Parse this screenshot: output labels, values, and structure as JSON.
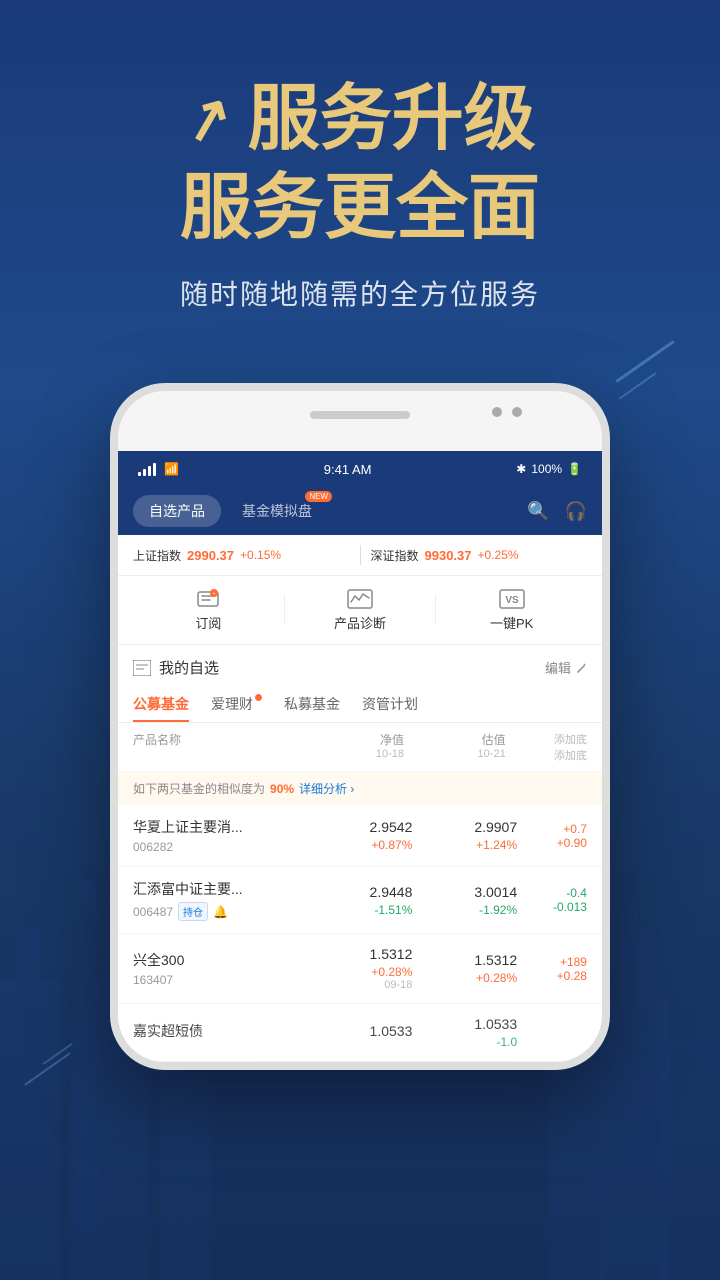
{
  "hero": {
    "title1": "服务升级",
    "title2": "服务更全面",
    "subtitle": "随时随地随需的全方位服务",
    "arrow": "↗"
  },
  "status_bar": {
    "time": "9:41 AM",
    "battery": "100%",
    "bluetooth": "✱"
  },
  "nav": {
    "tab1": "自选产品",
    "tab2": "基金模拟盘",
    "badge": "NEW",
    "search_icon": "search",
    "headset_icon": "headset"
  },
  "ticker": {
    "sh_label": "上证指数",
    "sh_value": "2990.37",
    "sh_change": "+0.15%",
    "sz_label": "深证指数",
    "sz_value": "9930.37",
    "sz_change": "+0.25%"
  },
  "toolbar": {
    "item1_label": "订阅",
    "item2_label": "产品诊断",
    "item3_label": "一键PK"
  },
  "watchlist": {
    "title": "我的自选",
    "edit": "编辑",
    "categories": [
      "公募基金",
      "爱理财",
      "私募基金",
      "资管计划"
    ],
    "active_cat": 0,
    "ai_li_cai_badge": true
  },
  "table_headers": {
    "name": "产品名称",
    "nav": "净值",
    "nav_date": "10-18",
    "est": "估值",
    "est_date": "10-21",
    "add": "添加底\n添加底"
  },
  "similarity": {
    "text": "如下两只基金的相似度为",
    "percent": "90%",
    "link": "详细分析 ›"
  },
  "funds": [
    {
      "name": "华夏上证主要消...",
      "code": "006282",
      "nav_value": "2.9542",
      "nav_change": "+0.87%",
      "nav_change_dir": "up",
      "est_value": "2.9907",
      "est_change": "+1.24%",
      "est_change_dir": "up",
      "add_value1": "+0.7",
      "add_value2": "+0.90",
      "add_dir": "up",
      "has_hold": false,
      "has_bell": false
    },
    {
      "name": "汇添富中证主要...",
      "code": "006487",
      "nav_value": "2.9448",
      "nav_change": "-1.51%",
      "nav_change_dir": "down",
      "est_value": "3.0014",
      "est_change": "-1.92%",
      "est_change_dir": "down",
      "add_value1": "-0.4",
      "add_value2": "-0.013",
      "add_dir": "down",
      "has_hold": true,
      "has_bell": true
    },
    {
      "name": "兴全300",
      "code": "163407",
      "nav_value": "1.5312",
      "nav_change": "+0.28%",
      "nav_change_dir": "up",
      "nav_date": "09-18",
      "est_value": "1.5312",
      "est_change": "+0.28%",
      "est_change_dir": "up",
      "add_value1": "+189",
      "add_value2": "+0.28",
      "add_dir": "up",
      "has_hold": false,
      "has_bell": false
    },
    {
      "name": "嘉实超短债",
      "code": "",
      "nav_value": "1.0533",
      "nav_change": "",
      "nav_change_dir": "neutral",
      "est_value": "1.0533",
      "est_change": "-1.0",
      "est_change_dir": "down",
      "add_value1": "",
      "add_value2": "",
      "has_hold": false,
      "has_bell": false
    }
  ],
  "colors": {
    "primary_bg": "#1a3a7a",
    "accent_gold": "#e8c87a",
    "accent_orange": "#ff6b35",
    "accent_green": "#22aa66",
    "white": "#ffffff"
  }
}
